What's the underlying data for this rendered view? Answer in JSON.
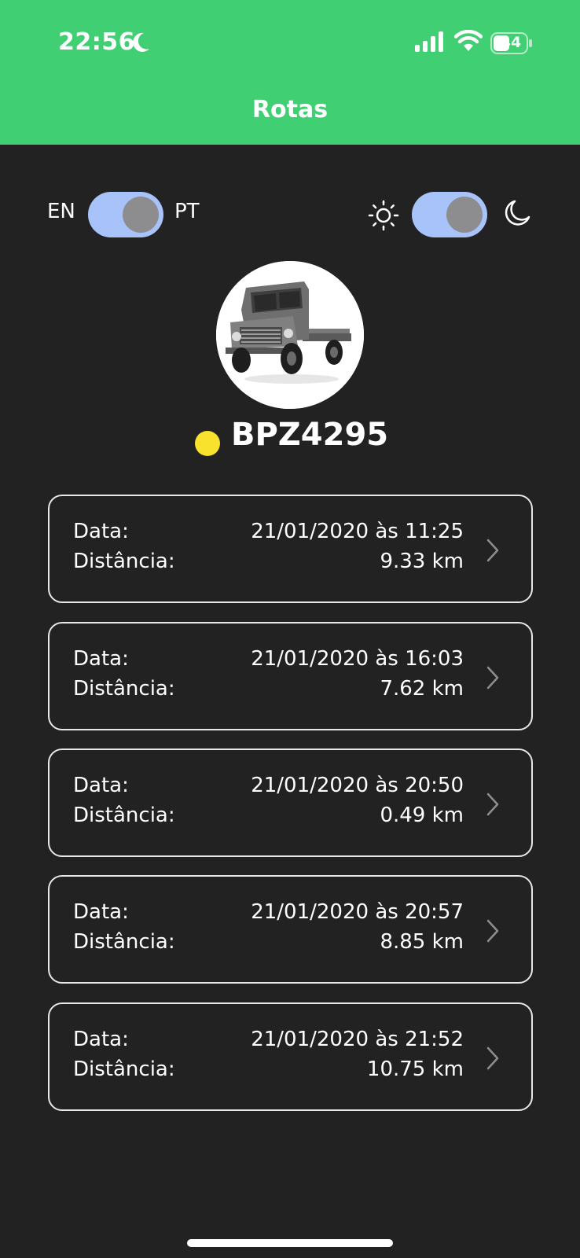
{
  "status_bar": {
    "time": "22:56",
    "battery": "44"
  },
  "header": {
    "title": "Rotas",
    "color": "#40cf72"
  },
  "settings": {
    "lang_left": "EN",
    "lang_right": "PT",
    "toggle_color": "#a8c3f9"
  },
  "vehicle": {
    "plate": "BPZ4295",
    "status_color": "#f8e22d"
  },
  "route_labels": {
    "date": "Data:",
    "distance": "Distância:"
  },
  "routes": [
    {
      "date": "21/01/2020 às 11:25",
      "distance": "9.33 km"
    },
    {
      "date": "21/01/2020 às 16:03",
      "distance": "7.62 km"
    },
    {
      "date": "21/01/2020 às 20:50",
      "distance": "0.49 km"
    },
    {
      "date": "21/01/2020 às 20:57",
      "distance": "8.85 km"
    },
    {
      "date": "21/01/2020 às 21:52",
      "distance": "10.75 km"
    }
  ],
  "icons": [
    "moon-icon",
    "signal-icon",
    "wifi-icon",
    "battery-icon",
    "sun-icon",
    "chevron-right-icon",
    "truck-photo"
  ]
}
